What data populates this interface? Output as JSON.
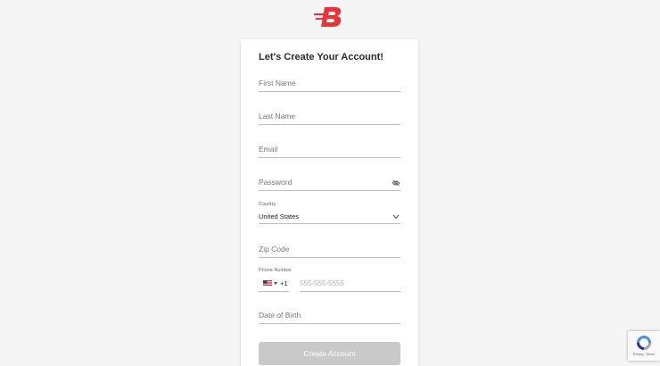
{
  "brand": {
    "logo_letter": "B",
    "logo_color": "#e8323c"
  },
  "form": {
    "title": "Let's Create Your Account!",
    "first_name_placeholder": "First Name",
    "last_name_placeholder": "Last Name",
    "email_placeholder": "Email",
    "password_placeholder": "Password",
    "country_label": "Country",
    "country_value": "United States",
    "zip_placeholder": "Zip Code",
    "phone_label": "Phone Number",
    "phone_country_code": "+1",
    "phone_placeholder": "555-555-5555",
    "dob_placeholder": "Date of Birth",
    "submit_label": "Create Account"
  },
  "icons": {
    "password_toggle": "eye-off-icon",
    "country_dropdown": "chevron-down-icon",
    "phone_flag": "us-flag-icon",
    "recaptcha": "recaptcha-icon"
  },
  "recaptcha": {
    "links": "Privacy - Terms"
  },
  "colors": {
    "background": "#f5f5f5",
    "button_disabled": "#c9c9c9",
    "brand_red": "#e8323c"
  }
}
